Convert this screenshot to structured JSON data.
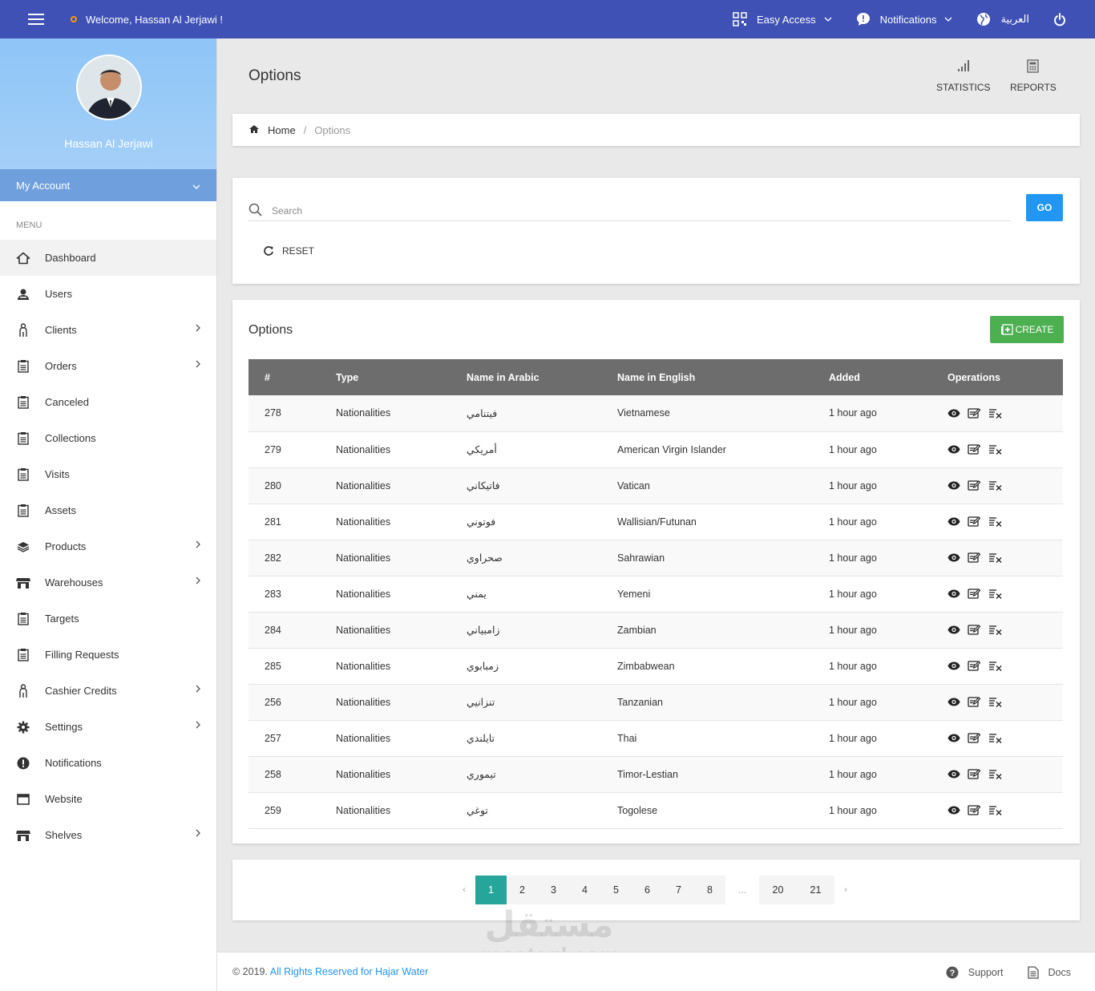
{
  "topbar": {
    "welcome": "Welcome, Hassan Al Jerjawi !",
    "easy_access": "Easy Access",
    "notifications": "Notifications",
    "language": "العربية"
  },
  "sidebar": {
    "profile_name": "Hassan Al Jerjawi",
    "my_account": "My Account",
    "menu_label": "MENU",
    "items": [
      {
        "label": "Dashboard",
        "icon": "home-icon",
        "has_sub": false
      },
      {
        "label": "Users",
        "icon": "users-icon",
        "has_sub": false
      },
      {
        "label": "Clients",
        "icon": "person-icon",
        "has_sub": true
      },
      {
        "label": "Orders",
        "icon": "clipboard-icon",
        "has_sub": true
      },
      {
        "label": "Canceled",
        "icon": "clipboard-icon",
        "has_sub": false
      },
      {
        "label": "Collections",
        "icon": "clipboard-icon",
        "has_sub": false
      },
      {
        "label": "Visits",
        "icon": "clipboard-icon",
        "has_sub": false
      },
      {
        "label": "Assets",
        "icon": "clipboard-icon",
        "has_sub": false
      },
      {
        "label": "Products",
        "icon": "layers-icon",
        "has_sub": true
      },
      {
        "label": "Warehouses",
        "icon": "store-icon",
        "has_sub": true
      },
      {
        "label": "Targets",
        "icon": "clipboard-icon",
        "has_sub": false
      },
      {
        "label": "Filling Requests",
        "icon": "clipboard-icon",
        "has_sub": false
      },
      {
        "label": "Cashier Credits",
        "icon": "person-icon",
        "has_sub": true
      },
      {
        "label": "Settings",
        "icon": "gear-icon",
        "has_sub": true
      },
      {
        "label": "Notifications",
        "icon": "alert-icon",
        "has_sub": false
      },
      {
        "label": "Website",
        "icon": "window-icon",
        "has_sub": false
      },
      {
        "label": "Shelves",
        "icon": "store-icon",
        "has_sub": true
      }
    ]
  },
  "header": {
    "title": "Options",
    "statistics": "STATISTICS",
    "reports": "REPORTS"
  },
  "breadcrumb": {
    "home": "Home",
    "separator": "/",
    "current": "Options"
  },
  "search": {
    "placeholder": "Search",
    "go": "GO",
    "reset": "RESET"
  },
  "table": {
    "title": "Options",
    "create": "CREATE",
    "columns": [
      "#",
      "Type",
      "Name in Arabic",
      "Name in English",
      "Added",
      "Operations"
    ],
    "rows": [
      {
        "id": "278",
        "type": "Nationalities",
        "ar": "فيتنامي",
        "en": "Vietnamese",
        "added": "1 hour ago"
      },
      {
        "id": "279",
        "type": "Nationalities",
        "ar": "أمريكي",
        "en": "American Virgin Islander",
        "added": "1 hour ago"
      },
      {
        "id": "280",
        "type": "Nationalities",
        "ar": "فاتيكاني",
        "en": "Vatican",
        "added": "1 hour ago"
      },
      {
        "id": "281",
        "type": "Nationalities",
        "ar": "فوتوني",
        "en": "Wallisian/Futunan",
        "added": "1 hour ago"
      },
      {
        "id": "282",
        "type": "Nationalities",
        "ar": "صحراوي",
        "en": "Sahrawian",
        "added": "1 hour ago"
      },
      {
        "id": "283",
        "type": "Nationalities",
        "ar": "يمني",
        "en": "Yemeni",
        "added": "1 hour ago"
      },
      {
        "id": "284",
        "type": "Nationalities",
        "ar": "زامبياني",
        "en": "Zambian",
        "added": "1 hour ago"
      },
      {
        "id": "285",
        "type": "Nationalities",
        "ar": "زمبابوي",
        "en": "Zimbabwean",
        "added": "1 hour ago"
      },
      {
        "id": "256",
        "type": "Nationalities",
        "ar": "تنزانيي",
        "en": "Tanzanian",
        "added": "1 hour ago"
      },
      {
        "id": "257",
        "type": "Nationalities",
        "ar": "تايلندي",
        "en": "Thai",
        "added": "1 hour ago"
      },
      {
        "id": "258",
        "type": "Nationalities",
        "ar": "تيموري",
        "en": "Timor-Lestian",
        "added": "1 hour ago"
      },
      {
        "id": "259",
        "type": "Nationalities",
        "ar": "توغي",
        "en": "Togolese",
        "added": "1 hour ago"
      }
    ]
  },
  "pagination": {
    "prev": "‹",
    "next": "›",
    "pages": [
      "1",
      "2",
      "3",
      "4",
      "5",
      "6",
      "7",
      "8"
    ],
    "ellipsis": "...",
    "last_pages": [
      "20",
      "21"
    ],
    "current": "1"
  },
  "footer": {
    "copyright": "© 2019.",
    "rights_link": "All Rights Reserved for Hajar Water",
    "support": "Support",
    "docs": "Docs"
  },
  "watermark": {
    "arabic": "مستقل",
    "latin": "mostaql.com"
  },
  "colors": {
    "topbar": "#3f51b5",
    "go_button": "#2196f3",
    "create_button": "#4caf50",
    "active_page": "#26a69a",
    "table_header": "#6d6d6d"
  }
}
